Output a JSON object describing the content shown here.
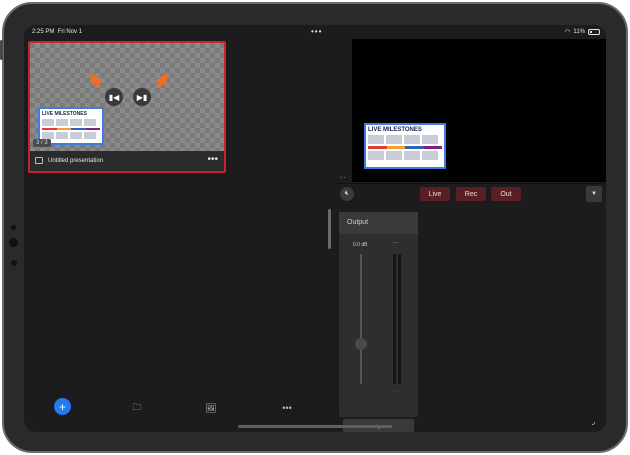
{
  "status_bar": {
    "time": "2:25 PM",
    "date": "Fri Nov 1",
    "dots": "•••",
    "battery": "11%"
  },
  "presentation": {
    "title": "Untitled presentation",
    "counter": "3 / 3",
    "slide_title": "LIVE MILESTONES",
    "more_label": "•••"
  },
  "program_preview": {
    "slide_title": "LIVE MILESTONES"
  },
  "controls": {
    "live_label": "Live",
    "rec_label": "Rec",
    "out_label": "Out",
    "accent": "#5a1f24"
  },
  "output_panel": {
    "title": "Output",
    "level": "0.0 dB",
    "meter_label": "- -"
  },
  "bottom_toolbar": {
    "more_label": "•••"
  },
  "colors": {
    "selection_border": "#c8232c",
    "add_button": "#1f7cf2",
    "thumb_border": "#3f7be0"
  }
}
